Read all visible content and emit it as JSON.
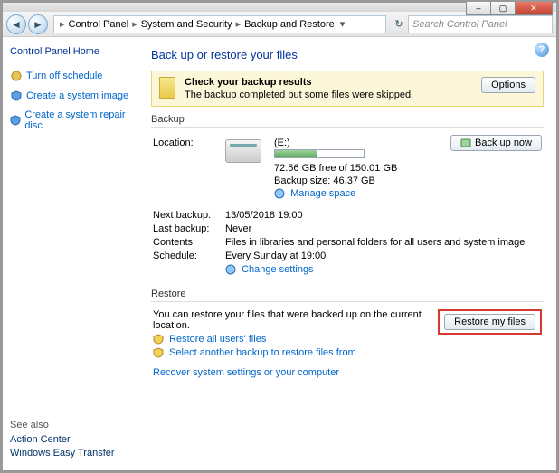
{
  "window": {
    "min_label": "–",
    "max_label": "▢",
    "close_label": "✕"
  },
  "nav": {
    "back": "◄",
    "fwd": "►",
    "crumbs": [
      "Control Panel",
      "System and Security",
      "Backup and Restore"
    ],
    "refresh": "↻",
    "search_placeholder": "Search Control Panel"
  },
  "sidebar": {
    "home": "Control Panel Home",
    "links": [
      {
        "label": "Turn off schedule"
      },
      {
        "label": "Create a system image"
      },
      {
        "label": "Create a system repair disc"
      }
    ],
    "see_also_hdr": "See also",
    "see_also": [
      "Action Center",
      "Windows Easy Transfer"
    ]
  },
  "page": {
    "title": "Back up or restore your files",
    "help": "?"
  },
  "banner": {
    "heading": "Check your backup results",
    "body": "The backup completed but some files were skipped.",
    "button": "Options"
  },
  "backup": {
    "group": "Backup",
    "backup_now": "Back up now",
    "location_k": "Location:",
    "location_v": "(E:)",
    "free_space": "72.56 GB free of 150.01 GB",
    "backup_size": "Backup size: 46.37 GB",
    "manage_space": "Manage space",
    "rows": [
      {
        "k": "Next backup:",
        "v": "13/05/2018 19:00"
      },
      {
        "k": "Last backup:",
        "v": "Never"
      },
      {
        "k": "Contents:",
        "v": "Files in libraries and personal folders for all users and system image"
      },
      {
        "k": "Schedule:",
        "v": "Every Sunday at 19:00"
      }
    ],
    "change_settings": "Change settings"
  },
  "restore": {
    "group": "Restore",
    "lead": "You can restore your files that were backed up on the current location.",
    "restore_my_files": "Restore my files",
    "restore_all": "Restore all users' files",
    "select_another": "Select another backup to restore files from",
    "recover": "Recover system settings or your computer"
  }
}
